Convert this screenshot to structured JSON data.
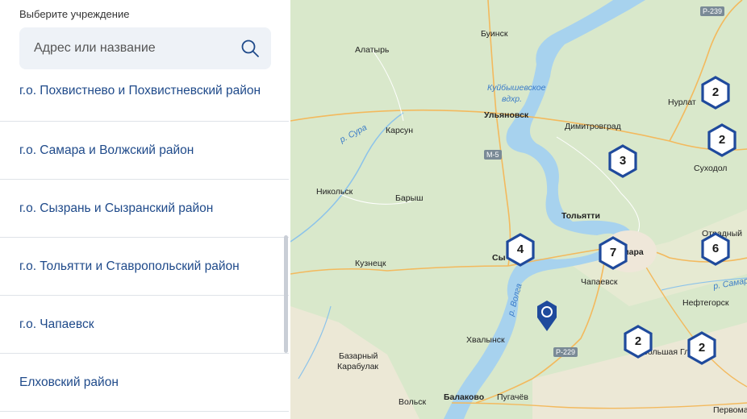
{
  "sidebar": {
    "label": "Выберите учреждение",
    "search": {
      "placeholder": "Адрес или название",
      "value": ""
    },
    "items": [
      {
        "label": "г.о. Похвистнево и Похвистневский район"
      },
      {
        "label": "г.о. Самара и Волжский район"
      },
      {
        "label": "г.о. Сызрань и Сызранский район"
      },
      {
        "label": "г.о. Тольятти и Ставропольский район"
      },
      {
        "label": "г.о. Чапаевск"
      },
      {
        "label": "Елховский район"
      }
    ]
  },
  "map": {
    "cities": {
      "buinsk": "Буинск",
      "alatyr": "Алатырь",
      "ulyanovsk": "Ульяновск",
      "dimitrovgrad": "Димитровград",
      "nurlat": "Нурлат",
      "karsun": "Карсун",
      "nikolsk": "Никольск",
      "barysh": "Барыш",
      "kuznetsk": "Кузнецк",
      "tolyatti": "Тольятти",
      "syzran": "Сы",
      "samara": "мара",
      "chapaevsk": "Чапаевск",
      "otradny": "Отрадный",
      "neftegorsk": "Нефтегорск",
      "khvalynsk": "Хвалынск",
      "bazarny": "Базарный",
      "karabulak": "Карабулак",
      "volsk": "Вольск",
      "balakovo": "Балаково",
      "pugachev": "Пугачёв",
      "suhodol": "Суходол",
      "glushitsa": "Большая Глушица",
      "pervomay": "Первома"
    },
    "water": {
      "reservoir": "Куйбышевское",
      "reservoir2": "вдхр.",
      "sura": "р. Сура",
      "volga": "р. Волга",
      "samara_river": "р. Самар"
    },
    "roads": {
      "p239": "Р-239",
      "m5": "М-5",
      "p229": "Р-229"
    },
    "clusters": [
      {
        "count": "2"
      },
      {
        "count": "2"
      },
      {
        "count": "3"
      },
      {
        "count": "4"
      },
      {
        "count": "7"
      },
      {
        "count": "6"
      },
      {
        "count": "2"
      },
      {
        "count": "2"
      }
    ],
    "colors": {
      "cluster_border": "#1f4a9c",
      "pin": "#1f4a9c",
      "land": "#d7e6c8",
      "water": "#a9d4ee",
      "road": "#f2b35a"
    }
  }
}
